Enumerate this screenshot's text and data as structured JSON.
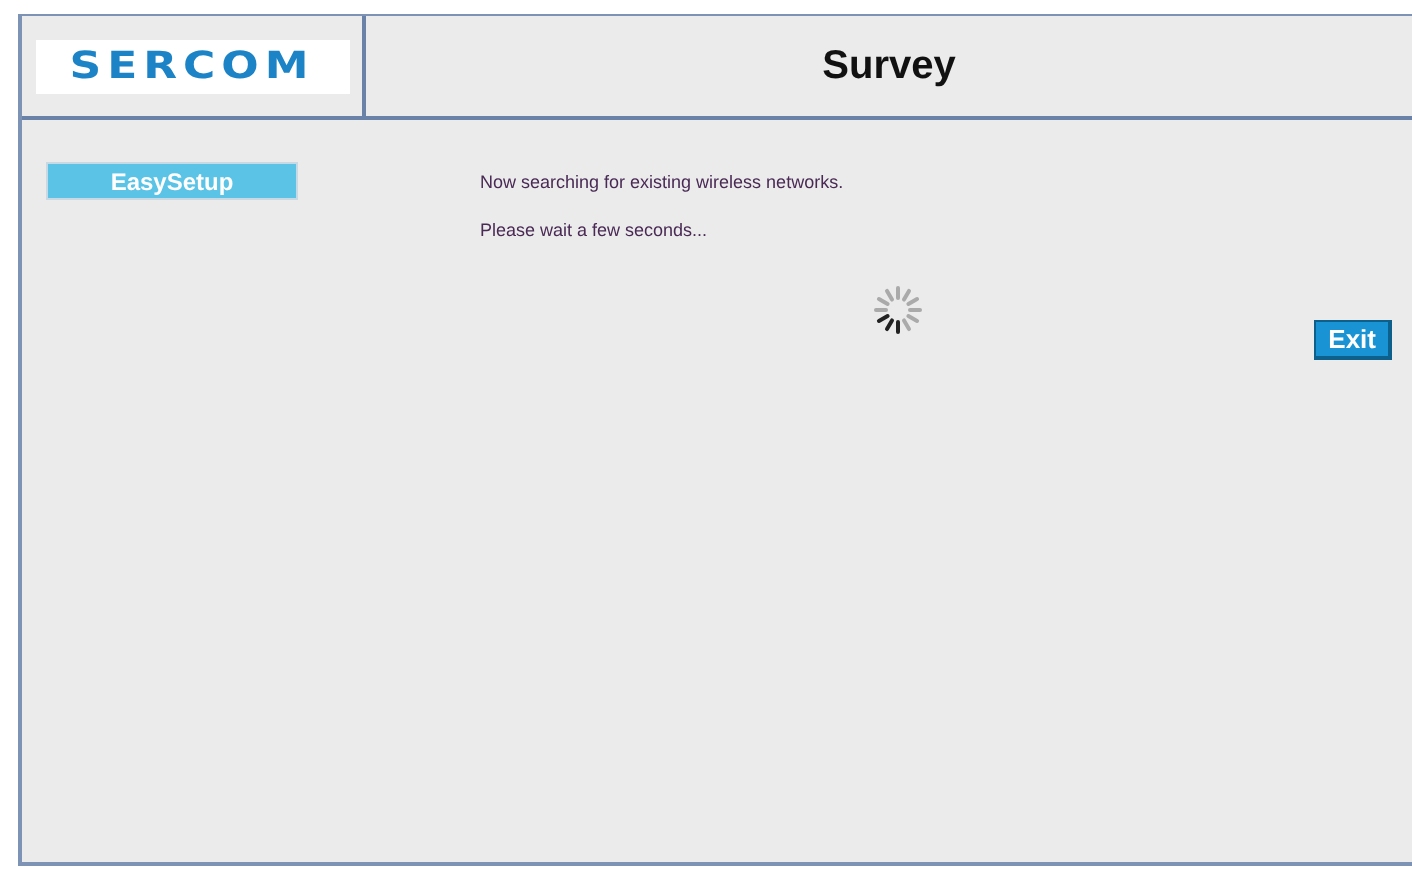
{
  "header": {
    "logo": "SERCOM",
    "title": "Survey"
  },
  "sidebar": {
    "items": [
      {
        "label": "EasySetup",
        "selected": true
      }
    ]
  },
  "content": {
    "messages": [
      "Now searching for existing wireless networks.",
      "Please wait a few seconds..."
    ],
    "loading": true,
    "buttons": [
      "Exit"
    ]
  }
}
